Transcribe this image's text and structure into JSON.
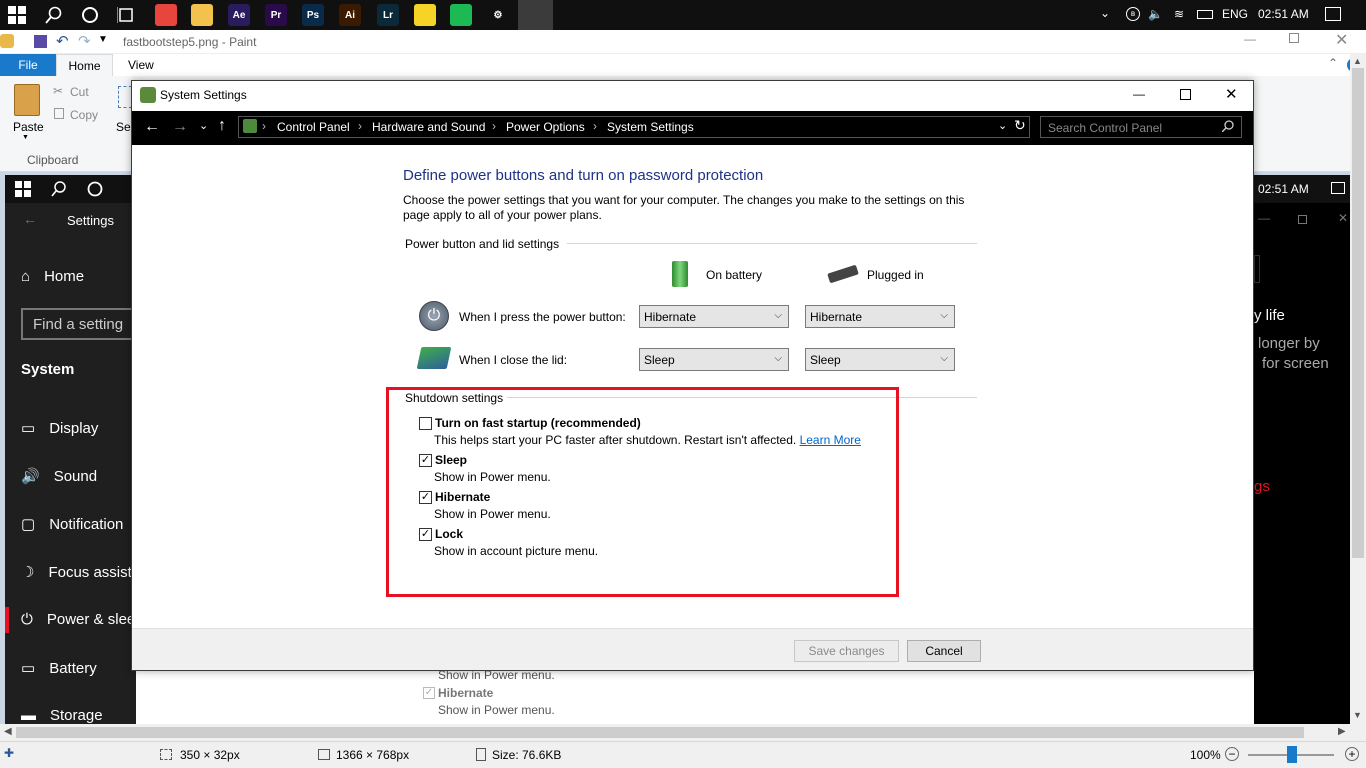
{
  "taskbar": {
    "tray_lang": "ENG",
    "tray_time": "02:51 AM",
    "apps": [
      {
        "name": "chrome-icon",
        "label": "",
        "color": "#e8453c"
      },
      {
        "name": "file-explorer-icon",
        "label": "",
        "color": "#f2c14e"
      },
      {
        "name": "after-effects-icon",
        "label": "Ae",
        "color": "#2a1a5e"
      },
      {
        "name": "premiere-icon",
        "label": "Pr",
        "color": "#2a0a4a"
      },
      {
        "name": "photoshop-icon",
        "label": "Ps",
        "color": "#0a2a4a"
      },
      {
        "name": "illustrator-icon",
        "label": "Ai",
        "color": "#3a1a00"
      },
      {
        "name": "lightroom-icon",
        "label": "Lr",
        "color": "#0a2a3a"
      },
      {
        "name": "sticky-notes-icon",
        "label": "",
        "color": "#f5d327"
      },
      {
        "name": "spotify-icon",
        "label": "",
        "color": "#1db954"
      },
      {
        "name": "settings-icon",
        "label": "⚙",
        "color": "#101010"
      },
      {
        "name": "control-panel-icon",
        "label": "",
        "color": "#3c6ea8"
      },
      {
        "name": "paint-icon",
        "label": "",
        "color": "#101010"
      }
    ]
  },
  "paint": {
    "title": "fastbootstep5.png - Paint",
    "tabs": {
      "file": "File",
      "home": "Home",
      "view": "View"
    },
    "clipboard": {
      "paste": "Paste",
      "cut": "Cut",
      "copy": "Copy",
      "group": "Clipboard",
      "select_partial": "Sel"
    },
    "status": {
      "selection": "350 × 32px",
      "dimensions": "1366 × 768px",
      "size": "Size: 76.6KB",
      "zoom": "100%"
    }
  },
  "inner": {
    "time": "02:51 AM",
    "settings_title": "Settings",
    "home": "Home",
    "search_placeholder": "Find a setting",
    "section": "System",
    "items": [
      "Display",
      "Sound",
      "Notification",
      "Focus assist",
      "Power & slee",
      "Battery",
      "Storage"
    ],
    "right_text": [
      "y life",
      "longer by",
      "for screen",
      "gs"
    ],
    "behind_lines": [
      "Show in Power menu.",
      "Hibernate",
      "Show in Power menu."
    ]
  },
  "dialog": {
    "title": "System Settings",
    "breadcrumb": [
      "Control Panel",
      "Hardware and Sound",
      "Power Options",
      "System Settings"
    ],
    "search_placeholder": "Search Control Panel",
    "heading": "Define power buttons and turn on password protection",
    "description_1": "Choose the power settings that you want for your computer. The changes you make to the settings on this",
    "description_2": "page apply to all of your power plans.",
    "group_power": "Power button and lid settings",
    "col_battery": "On battery",
    "col_plugged": "Plugged in",
    "row_power": {
      "label": "When I press the power button:",
      "battery": "Hibernate",
      "plugged": "Hibernate"
    },
    "row_lid": {
      "label": "When I close the lid:",
      "battery": "Sleep",
      "plugged": "Sleep"
    },
    "group_shutdown": "Shutdown settings",
    "options": [
      {
        "label": "Turn on fast startup (recommended)",
        "checked": false,
        "desc": "This helps start your PC faster after shutdown. Restart isn't affected.",
        "link": "Learn More"
      },
      {
        "label": "Sleep",
        "checked": true,
        "desc": "Show in Power menu.",
        "link": ""
      },
      {
        "label": "Hibernate",
        "checked": true,
        "desc": "Show in Power menu.",
        "link": ""
      },
      {
        "label": "Lock",
        "checked": true,
        "desc": "Show in account picture menu.",
        "link": ""
      }
    ],
    "save": "Save changes",
    "cancel": "Cancel",
    "highlight_color": "#e81123"
  }
}
